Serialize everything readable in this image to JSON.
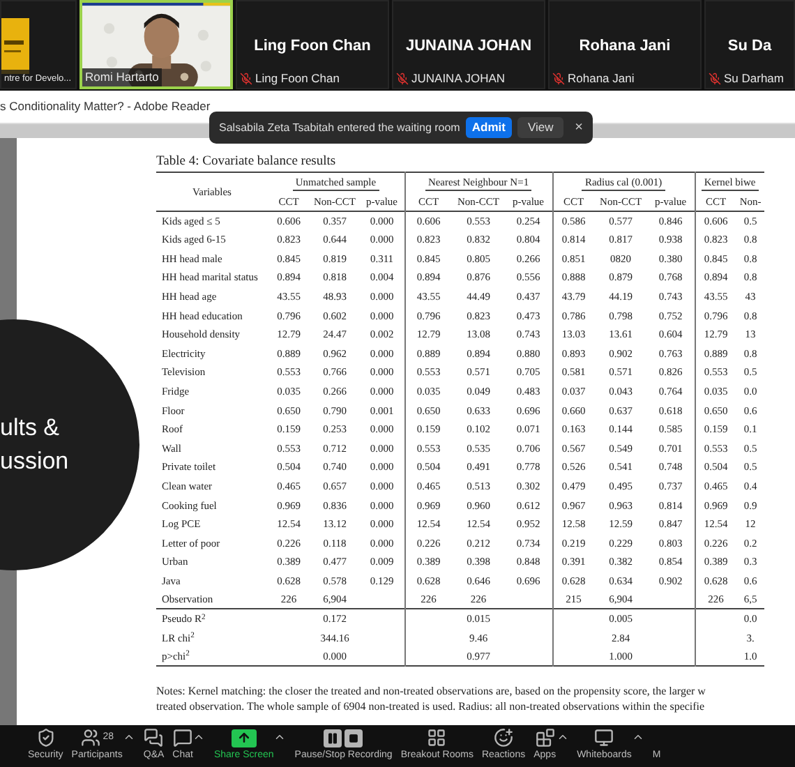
{
  "participants": [
    {
      "kind": "logo",
      "label": "ntre for Develo...",
      "muted": false,
      "speaking": false
    },
    {
      "kind": "video",
      "label": "Romi Hartarto",
      "muted": false,
      "speaking": true
    },
    {
      "kind": "name",
      "name": "Ling Foon Chan",
      "label": "Ling Foon Chan",
      "muted": true,
      "speaking": false
    },
    {
      "kind": "name",
      "name": "JUNAINA JOHAN",
      "label": "JUNAINA JOHAN",
      "muted": true,
      "speaking": false
    },
    {
      "kind": "name",
      "name": "Rohana Jani",
      "label": "Rohana Jani",
      "muted": true,
      "speaking": false
    },
    {
      "kind": "name",
      "name": "Su Da",
      "label": "Su Darham",
      "muted": true,
      "speaking": false
    }
  ],
  "window": {
    "title": "s Conditionality Matter? - Adobe Reader"
  },
  "notification": {
    "message": "Salsabila Zeta Tsabitah entered the waiting room",
    "buttons": [
      {
        "label": "Admit",
        "kind": "primary"
      },
      {
        "label": "View",
        "kind": "secondary"
      }
    ],
    "close": "×"
  },
  "slide_heading": {
    "lines": [
      "ults &",
      "ussion"
    ]
  },
  "table": {
    "caption": "Table 4: Covariate balance results",
    "variables_header": "Variables",
    "groups": [
      {
        "title": "Unmatched sample",
        "columns": [
          "CCT",
          "Non-CCT",
          "p-value"
        ]
      },
      {
        "title": "Nearest Neighbour N=1",
        "columns": [
          "CCT",
          "Non-CCT",
          "p-value"
        ]
      },
      {
        "title": "Radius cal (0.001)",
        "columns": [
          "CCT",
          "Non-CCT",
          "p-value"
        ]
      },
      {
        "title": "Kernel biwe",
        "columns": [
          "CCT",
          "Non-"
        ]
      }
    ],
    "rows": [
      {
        "variable": "Kids aged ≤ 5",
        "cells": [
          "0.606",
          "0.357",
          "0.000",
          "0.606",
          "0.553",
          "0.254",
          "0.586",
          "0.577",
          "0.846",
          "0.606",
          "0.5"
        ]
      },
      {
        "variable": "Kids aged 6-15",
        "cells": [
          "0.823",
          "0.644",
          "0.000",
          "0.823",
          "0.832",
          "0.804",
          "0.814",
          "0.817",
          "0.938",
          "0.823",
          "0.8"
        ]
      },
      {
        "variable": "HH head male",
        "cells": [
          "0.845",
          "0.819",
          "0.311",
          "0.845",
          "0.805",
          "0.266",
          "0.851",
          "0820",
          "0.380",
          "0.845",
          "0.8"
        ]
      },
      {
        "variable": "HH head marital status",
        "cells": [
          "0.894",
          "0.818",
          "0.004",
          "0.894",
          "0.876",
          "0.556",
          "0.888",
          "0.879",
          "0.768",
          "0.894",
          "0.8"
        ]
      },
      {
        "variable": "HH head age",
        "cells": [
          "43.55",
          "48.93",
          "0.000",
          "43.55",
          "44.49",
          "0.437",
          "43.79",
          "44.19",
          "0.743",
          "43.55",
          "43"
        ]
      },
      {
        "variable": "HH head education",
        "cells": [
          "0.796",
          "0.602",
          "0.000",
          "0.796",
          "0.823",
          "0.473",
          "0.786",
          "0.798",
          "0.752",
          "0.796",
          "0.8"
        ]
      },
      {
        "variable": "Household density",
        "cells": [
          "12.79",
          "24.47",
          "0.002",
          "12.79",
          "13.08",
          "0.743",
          "13.03",
          "13.61",
          "0.604",
          "12.79",
          "13"
        ]
      },
      {
        "variable": "Electricity",
        "cells": [
          "0.889",
          "0.962",
          "0.000",
          "0.889",
          "0.894",
          "0.880",
          "0.893",
          "0.902",
          "0.763",
          "0.889",
          "0.8"
        ]
      },
      {
        "variable": "Television",
        "cells": [
          "0.553",
          "0.766",
          "0.000",
          "0.553",
          "0.571",
          "0.705",
          "0.581",
          "0.571",
          "0.826",
          "0.553",
          "0.5"
        ]
      },
      {
        "variable": "Fridge",
        "cells": [
          "0.035",
          "0.266",
          "0.000",
          "0.035",
          "0.049",
          "0.483",
          "0.037",
          "0.043",
          "0.764",
          "0.035",
          "0.0"
        ]
      },
      {
        "variable": "Floor",
        "cells": [
          "0.650",
          "0.790",
          "0.001",
          "0.650",
          "0.633",
          "0.696",
          "0.660",
          "0.637",
          "0.618",
          "0.650",
          "0.6"
        ]
      },
      {
        "variable": "Roof",
        "cells": [
          "0.159",
          "0.253",
          "0.000",
          "0.159",
          "0.102",
          "0.071",
          "0.163",
          "0.144",
          "0.585",
          "0.159",
          "0.1"
        ]
      },
      {
        "variable": "Wall",
        "cells": [
          "0.553",
          "0.712",
          "0.000",
          "0.553",
          "0.535",
          "0.706",
          "0.567",
          "0.549",
          "0.701",
          "0.553",
          "0.5"
        ]
      },
      {
        "variable": "Private toilet",
        "cells": [
          "0.504",
          "0.740",
          "0.000",
          "0.504",
          "0.491",
          "0.778",
          "0.526",
          "0.541",
          "0.748",
          "0.504",
          "0.5"
        ]
      },
      {
        "variable": "Clean water",
        "cells": [
          "0.465",
          "0.657",
          "0.000",
          "0.465",
          "0.513",
          "0.302",
          "0.479",
          "0.495",
          "0.737",
          "0.465",
          "0.4"
        ]
      },
      {
        "variable": "Cooking fuel",
        "cells": [
          "0.969",
          "0.836",
          "0.000",
          "0.969",
          "0.960",
          "0.612",
          "0.967",
          "0.963",
          "0.814",
          "0.969",
          "0.9"
        ]
      },
      {
        "variable": "Log PCE",
        "cells": [
          "12.54",
          "13.12",
          "0.000",
          "12.54",
          "12.54",
          "0.952",
          "12.58",
          "12.59",
          "0.847",
          "12.54",
          "12"
        ]
      },
      {
        "variable": "Letter of poor",
        "cells": [
          "0.226",
          "0.118",
          "0.000",
          "0.226",
          "0.212",
          "0.734",
          "0.219",
          "0.229",
          "0.803",
          "0.226",
          "0.2"
        ]
      },
      {
        "variable": "Urban",
        "cells": [
          "0.389",
          "0.477",
          "0.009",
          "0.389",
          "0.398",
          "0.848",
          "0.391",
          "0.382",
          "0.854",
          "0.389",
          "0.3"
        ]
      },
      {
        "variable": "Java",
        "cells": [
          "0.628",
          "0.578",
          "0.129",
          "0.628",
          "0.646",
          "0.696",
          "0.628",
          "0.634",
          "0.902",
          "0.628",
          "0.6"
        ]
      },
      {
        "variable": "Observation",
        "cells": [
          "226",
          "6,904",
          null,
          "226",
          "226",
          null,
          "215",
          "6,904",
          null,
          "226",
          "6,5"
        ]
      }
    ],
    "stats": [
      {
        "label": "Pseudo R$^{2}$",
        "values": [
          "0.172",
          "0.015",
          "0.005",
          "0.0"
        ]
      },
      {
        "label": "LR chi$^{2}$",
        "values": [
          "344.16",
          "9.46",
          "2.84",
          "3."
        ]
      },
      {
        "label": "p>chi$^{2}$",
        "values": [
          "0.000",
          "0.977",
          "1.000",
          "1.0"
        ]
      }
    ]
  },
  "notes": [
    "Notes: Kernel matching: the closer the treated and non-treated observations are, based on the propensity score, the larger w",
    "treated observation. The whole sample of 6904 non-treated is used. Radius: all non-treated observations within the specifie"
  ],
  "toolbar": [
    {
      "kind": "security",
      "label": "Security",
      "caret": false
    },
    {
      "kind": "participants",
      "label": "Participants",
      "count": "28",
      "caret": true
    },
    {
      "kind": "qa",
      "label": "Q&A",
      "caret": false
    },
    {
      "kind": "chat",
      "label": "Chat",
      "caret": true
    },
    {
      "kind": "share",
      "label": "Share Screen",
      "caret": true
    },
    {
      "kind": "record",
      "label": "Pause/Stop Recording",
      "caret": false
    },
    {
      "kind": "breakout",
      "label": "Breakout Rooms",
      "caret": false
    },
    {
      "kind": "reactions",
      "label": "Reactions",
      "caret": false
    },
    {
      "kind": "apps",
      "label": "Apps",
      "caret": true
    },
    {
      "kind": "whiteboards",
      "label": "Whiteboards",
      "caret": true
    },
    {
      "kind": "more",
      "label": "M",
      "caret": false
    }
  ]
}
